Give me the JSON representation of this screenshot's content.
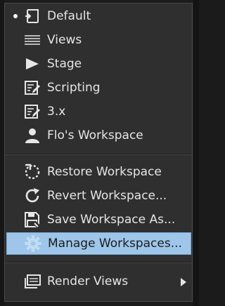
{
  "menu": {
    "items": [
      {
        "label": "Default",
        "icon": "restore-workspace-icon",
        "checked": true
      },
      {
        "label": "Views",
        "icon": "list-lines-icon"
      },
      {
        "label": "Stage",
        "icon": "play-triangle-icon"
      },
      {
        "label": "Scripting",
        "icon": "script-edit-icon"
      },
      {
        "label": "3.x",
        "icon": "script-edit-icon"
      },
      {
        "label": "Flo's Workspace",
        "icon": "user-icon"
      }
    ],
    "actions": [
      {
        "label": "Restore Workspace",
        "icon": "restore-icon"
      },
      {
        "label": "Revert Workspace...",
        "icon": "revert-icon"
      },
      {
        "label": "Save Workspace As...",
        "icon": "save-as-icon"
      },
      {
        "label": "Manage Workspaces...",
        "icon": "gear-icon",
        "highlighted": true
      }
    ],
    "render_views": {
      "label": "Render Views",
      "icon": "render-views-icon",
      "has_submenu": true
    }
  },
  "colors": {
    "menu_background": "#2f2f2f",
    "text": "#e6e6e6",
    "highlight": "#9ec6ea",
    "highlight_text": "#1c1c1c"
  }
}
